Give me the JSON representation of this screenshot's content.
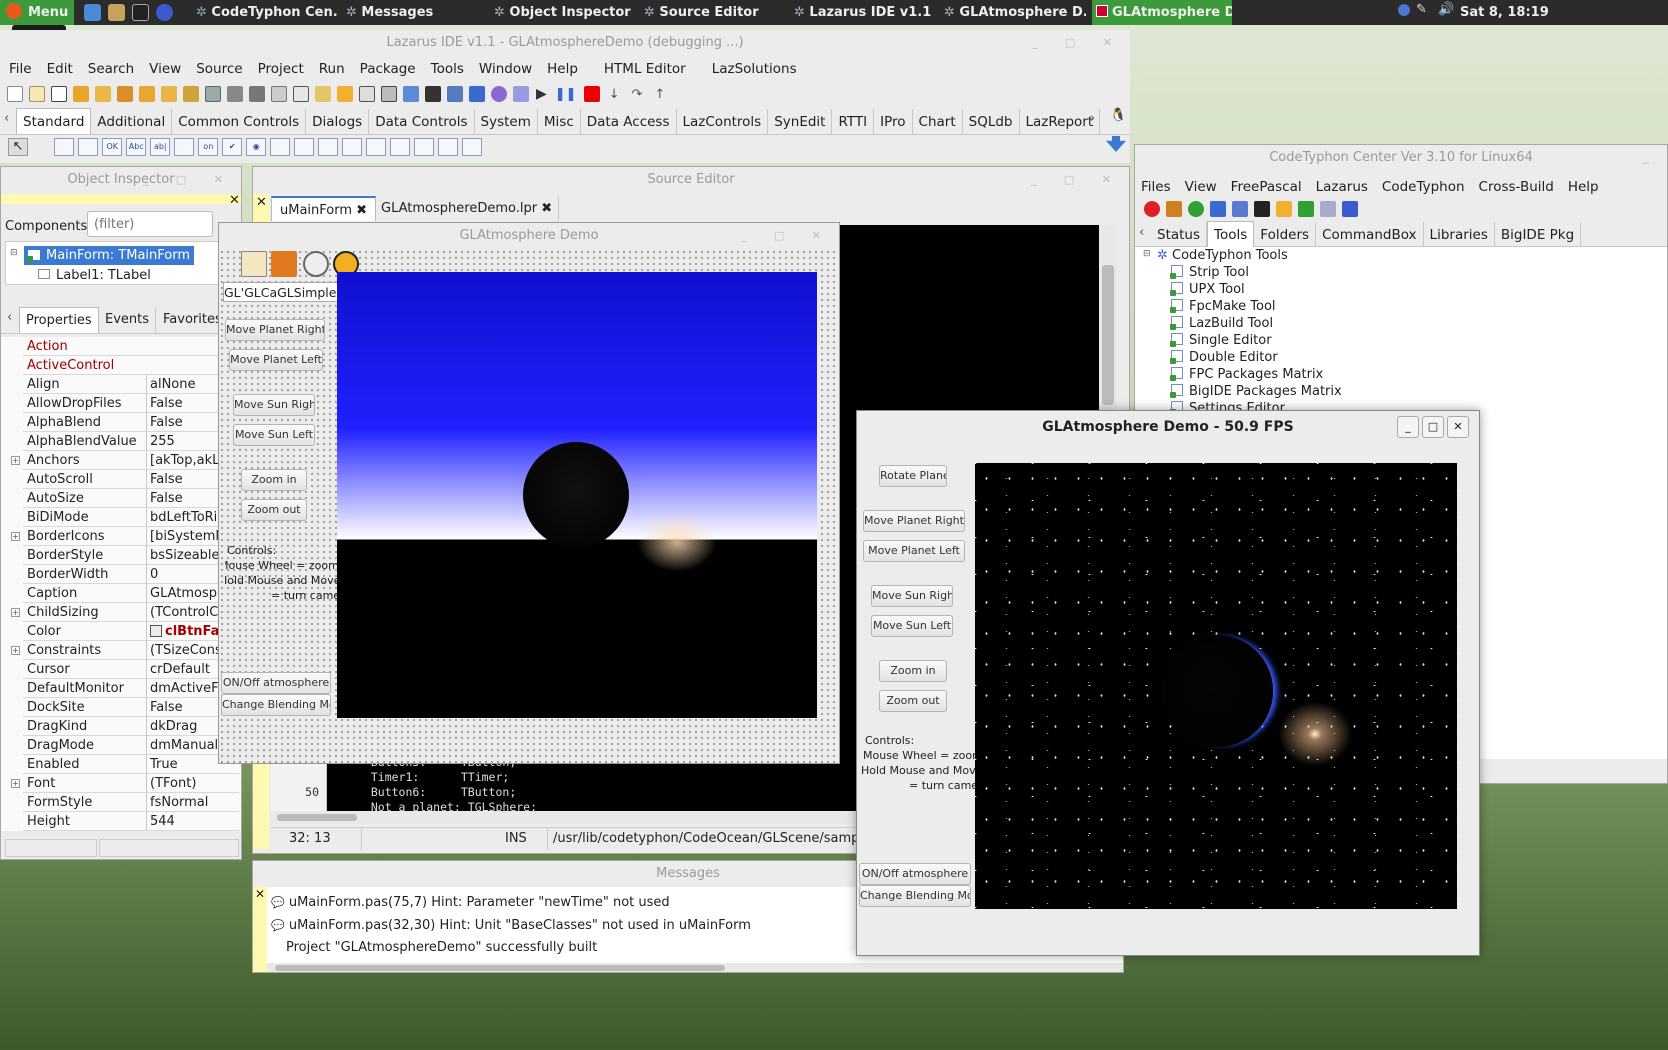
{
  "taskbar": {
    "menu_label": "Menu",
    "tasks": [
      "CodeTyphon Cen...",
      "Messages",
      "Object Inspector",
      "Source Editor",
      "Lazarus IDE v1.1 ...",
      "GLAtmosphere D...",
      "GLAtmosphere D..."
    ],
    "clock": "Sat  8, 18:19",
    "tooltip": "Menu"
  },
  "ide": {
    "title": "Lazarus IDE v1.1 - GLAtmosphereDemo (debugging ...)",
    "menu": [
      "File",
      "Edit",
      "Search",
      "View",
      "Source",
      "Project",
      "Run",
      "Package",
      "Tools",
      "Window",
      "Help",
      "HTML Editor",
      "LazSolutions"
    ],
    "palette_tabs": [
      "Standard",
      "Additional",
      "Common Controls",
      "Dialogs",
      "Data Controls",
      "System",
      "Misc",
      "Data Access",
      "LazControls",
      "SynEdit",
      "RTTI",
      "IPro",
      "Chart",
      "SQLdb",
      "LazReport"
    ],
    "component_icons": [
      "OK",
      "Abc",
      "ab|",
      "on"
    ]
  },
  "object_inspector": {
    "title": "Object Inspector",
    "components_label": "Components",
    "filter_placeholder": "(filter)",
    "tree": [
      "MainForm: TMainForm",
      "Label1: TLabel"
    ],
    "tabs": [
      "Properties",
      "Events",
      "Favorites"
    ],
    "props": [
      {
        "n": "Action",
        "v": "",
        "red": true
      },
      {
        "n": "ActiveControl",
        "v": "",
        "red": true
      },
      {
        "n": "Align",
        "v": "alNone"
      },
      {
        "n": "AllowDropFiles",
        "v": "False"
      },
      {
        "n": "AlphaBlend",
        "v": "False"
      },
      {
        "n": "AlphaBlendValue",
        "v": "255"
      },
      {
        "n": "Anchors",
        "v": "[akTop,akLe",
        "plus": true
      },
      {
        "n": "AutoScroll",
        "v": "False"
      },
      {
        "n": "AutoSize",
        "v": "False"
      },
      {
        "n": "BiDiMode",
        "v": "bdLeftToRig"
      },
      {
        "n": "BorderIcons",
        "v": "[biSystemM",
        "plus": true
      },
      {
        "n": "BorderStyle",
        "v": "bsSizeable"
      },
      {
        "n": "BorderWidth",
        "v": "0"
      },
      {
        "n": "Caption",
        "v": "GLAtmosph"
      },
      {
        "n": "ChildSizing",
        "v": "(TControlC",
        "plus": true
      },
      {
        "n": "Color",
        "v": "clBtnFac",
        "color": true
      },
      {
        "n": "Constraints",
        "v": "(TSizeConst",
        "plus": true
      },
      {
        "n": "Cursor",
        "v": "crDefault"
      },
      {
        "n": "DefaultMonitor",
        "v": "dmActiveFo"
      },
      {
        "n": "DockSite",
        "v": "False"
      },
      {
        "n": "DragKind",
        "v": "dkDrag"
      },
      {
        "n": "DragMode",
        "v": "dmManual"
      },
      {
        "n": "Enabled",
        "v": "True"
      },
      {
        "n": "Font",
        "v": "(TFont)",
        "plus": true
      },
      {
        "n": "FormStyle",
        "v": "fsNormal"
      },
      {
        "n": "Height",
        "v": "544"
      },
      {
        "n": "HelpContext",
        "v": "0"
      }
    ]
  },
  "source_editor": {
    "title": "Source Editor",
    "tabs": [
      "uMainForm",
      "GLAtmosphereDemo.lpr"
    ],
    "code": [
      {
        "ln": "",
        "t": "  Button5:     TButton;"
      },
      {
        "ln": "",
        "t": "  Timer1:      TTimer;"
      },
      {
        "ln": "50",
        "t": "  Button6:     TButton;"
      },
      {
        "ln": "",
        "t": "  Not_a_planet: TGLSphere;"
      }
    ],
    "cursor_pos": "32: 13",
    "mode": "INS",
    "path": "/usr/lib/codetyphon/CodeOcean/GLScene/samples"
  },
  "design_form": {
    "title": "GLAtmosphere Demo",
    "nav_label": "GL'GLCaGLSimpleNavigation1",
    "buttons": [
      "Move Planet Right",
      "Move Planet Left",
      "Move Sun Righ",
      "Move Sun Left",
      "Zoom in",
      "Zoom out",
      "ON/Off atmosphere",
      "Change Blending Mo"
    ],
    "controls_text": [
      "Controls:",
      "Mouse Wheel = zoom",
      "Hold Mouse and Move",
      "= turn camera"
    ]
  },
  "codetyphon": {
    "title": "CodeTyphon Center Ver 3.10 for Linux64",
    "menu": [
      "Files",
      "View",
      "FreePascal",
      "Lazarus",
      "CodeTyphon",
      "Cross-Build",
      "Help"
    ],
    "tabs": [
      "Status",
      "Tools",
      "Folders",
      "CommandBox",
      "Libraries",
      "BigIDE Pkg"
    ],
    "tree_root": "CodeTyphon Tools",
    "tree_items": [
      "Strip Tool",
      "UPX Tool",
      "FpcMake Tool",
      "LazBuild Tool",
      "Single Editor",
      "Double Editor",
      "FPC Packages Matrix",
      "BigIDE Packages Matrix",
      "Settings Editor"
    ]
  },
  "demo_window": {
    "title": "GLAtmosphere Demo - 50.9 FPS",
    "buttons": [
      "Rotate Plane",
      "Move Planet Right",
      "Move Planet Left",
      "Move Sun Righ",
      "Move Sun Left",
      "Zoom in",
      "Zoom out",
      "ON/Off atmosphere",
      "Change Blending Mo"
    ],
    "controls_text": [
      "Controls:",
      "Mouse Wheel = zoom",
      "Hold Mouse and Move",
      "= turn camera"
    ]
  },
  "messages": {
    "title": "Messages",
    "rows": [
      "uMainForm.pas(75,7) Hint: Parameter \"newTime\" not used",
      "uMainForm.pas(32,30) Hint: Unit \"BaseClasses\" not used in uMainForm",
      "Project \"GLAtmosphereDemo\" successfully built"
    ]
  }
}
